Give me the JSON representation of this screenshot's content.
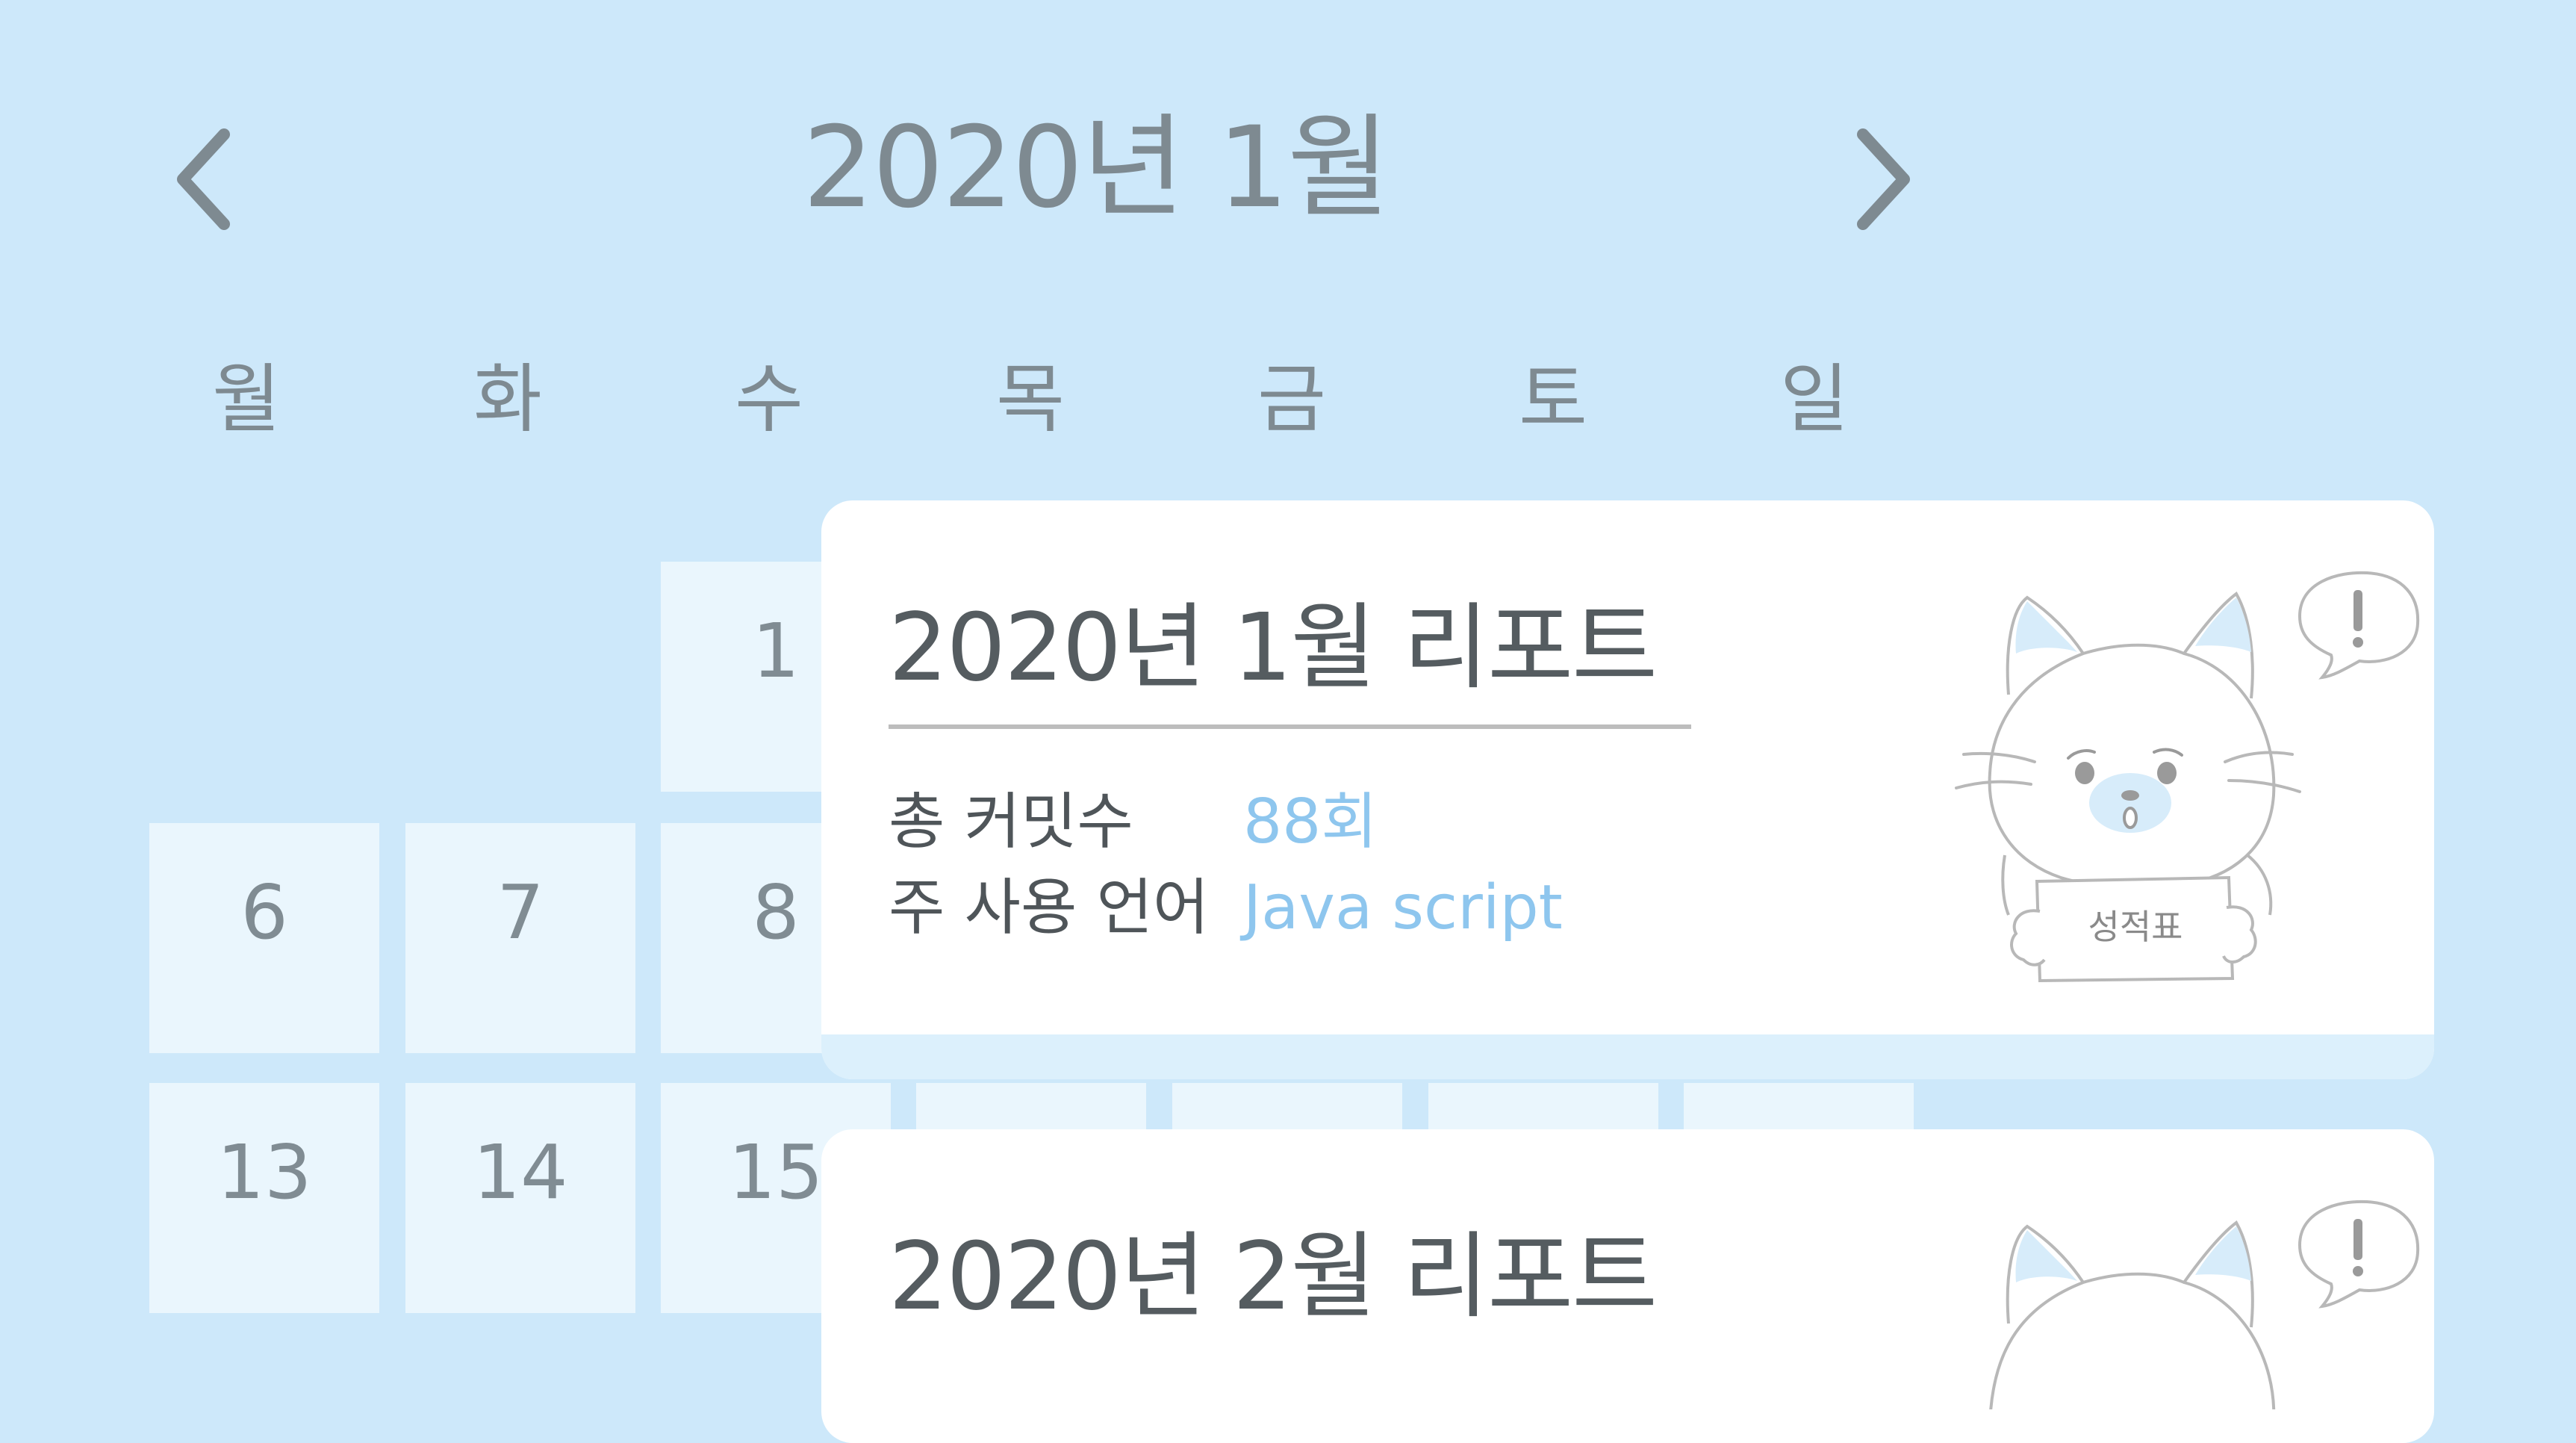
{
  "calendar": {
    "title": "2020년 1월",
    "weekdays": [
      "월",
      "화",
      "수",
      "목",
      "금",
      "토",
      "일"
    ],
    "days": [
      "1",
      "6",
      "7",
      "8",
      "13",
      "14",
      "15"
    ]
  },
  "reports": [
    {
      "title": "2020년 1월 리포트",
      "commit_label": "총 커밋수",
      "commit_value": "88회",
      "language_label": "주 사용 언어",
      "language_value": "Java script",
      "sign_text": "성적표"
    },
    {
      "title": "2020년 2월 리포트"
    }
  ],
  "icons": {
    "prev": "chevron-left-icon",
    "next": "chevron-right-icon",
    "mascot": "cat-mascot-icon",
    "exclaim": "exclamation-bubble-icon"
  },
  "colors": {
    "background": "#cde8fa",
    "cell": "#eaf6fd",
    "card": "#ffffff",
    "accent": "#8ec6ee",
    "text_gray": "#7e8a91"
  }
}
